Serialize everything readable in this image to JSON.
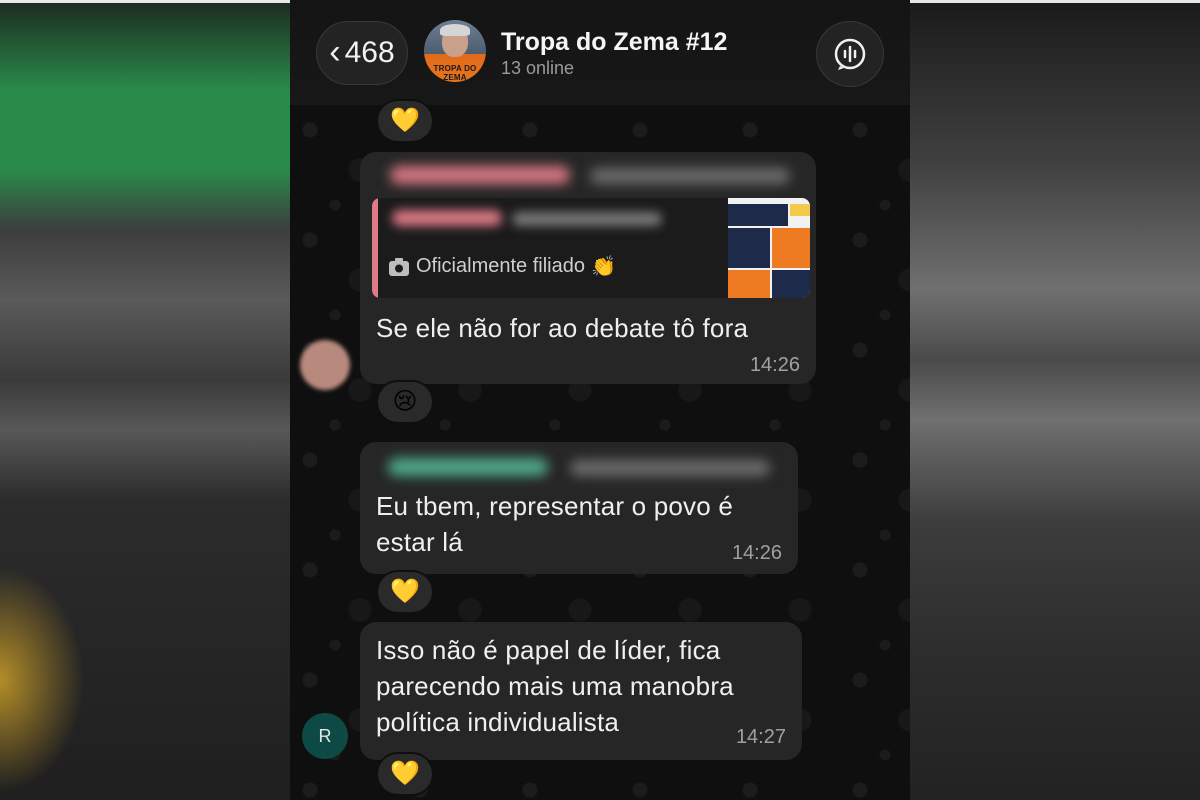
{
  "header": {
    "back_count": "468",
    "group_name": "Tropa do Zema #12",
    "status": "13 online",
    "avatar_tag": "TROPA DO ZEMA"
  },
  "messages": [
    {
      "quoted_text": "Oficialmente filiado",
      "text": "Se ele não for ao debate tô fora",
      "time": "14:26",
      "reaction": "😢"
    },
    {
      "text": "Eu tbem, representar o povo é estar lá",
      "time": "14:26",
      "reaction": "💛"
    },
    {
      "text": "Isso não é papel de líder, fica parecendo mais uma manobra política individualista",
      "time": "14:27",
      "reaction": "💛",
      "sender_initial": "R"
    }
  ],
  "top_reaction": "💛",
  "colors": {
    "bubble": "#262626",
    "background": "#0f0f0f",
    "avatar_r": "#0d4a45",
    "quote_bar": "#e07a86"
  },
  "icons": {
    "back": "chevron-left-icon",
    "call": "voice-call-icon",
    "camera": "camera-icon",
    "clap": "clapping-hands-emoji"
  }
}
